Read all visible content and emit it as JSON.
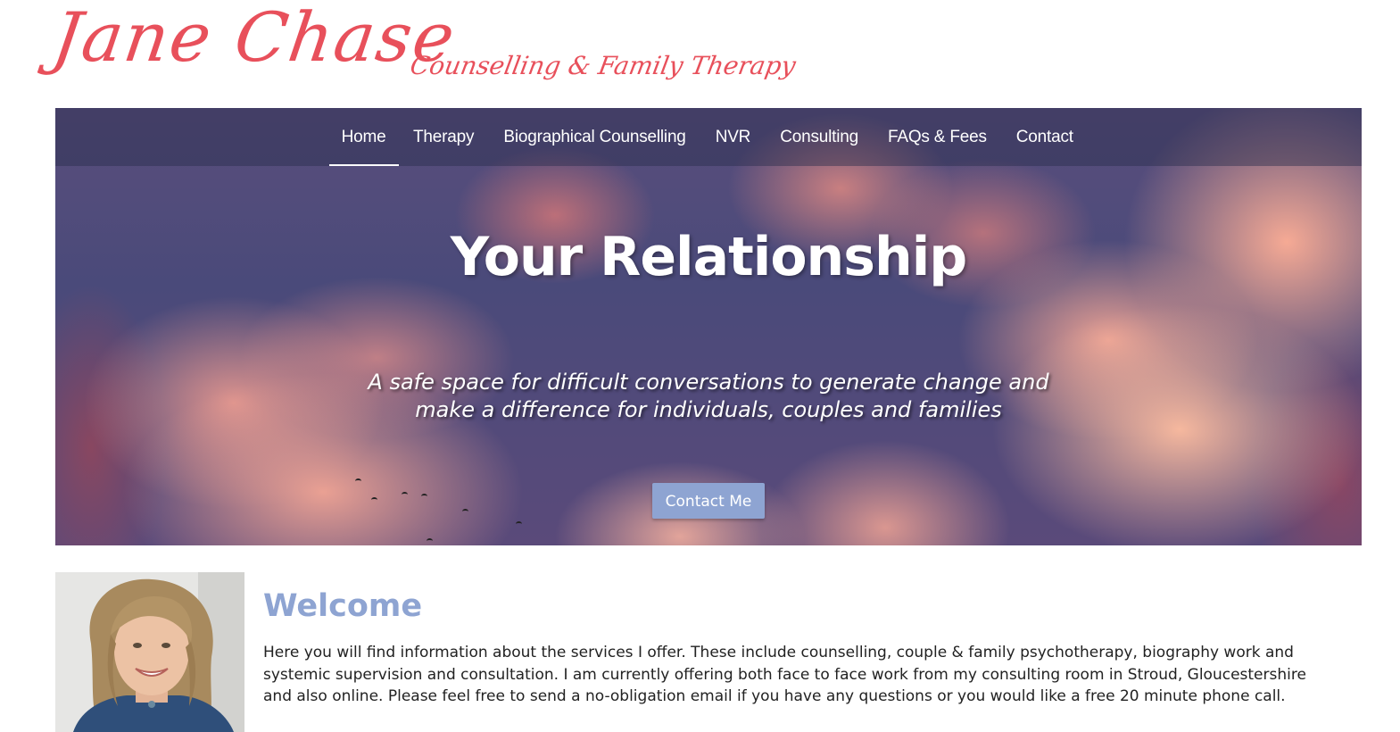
{
  "brand": {
    "name": "Jane Chase",
    "tagline": "Counselling & Family Therapy",
    "color": "#e8505b"
  },
  "nav": {
    "items": [
      {
        "label": "Home",
        "active": true
      },
      {
        "label": "Therapy",
        "active": false
      },
      {
        "label": "Biographical Counselling",
        "active": false
      },
      {
        "label": "NVR",
        "active": false
      },
      {
        "label": "Consulting",
        "active": false
      },
      {
        "label": "FAQs & Fees",
        "active": false
      },
      {
        "label": "Contact",
        "active": false
      }
    ]
  },
  "hero": {
    "title": "Your Relationship",
    "subtitle_line1": "A safe space for difficult conversations to generate change and",
    "subtitle_line2": "make a difference for individuals, couples and families",
    "button_label": "Contact Me",
    "button_color": "#8ea4d2"
  },
  "welcome": {
    "title": "Welcome",
    "title_color": "#8ea4d2",
    "text": "Here you will find information about the services I offer. These include counselling, couple & family psychotherapy, biography work and systemic supervision and consultation. I am currently offering both face to face work from my consulting room in Stroud, Gloucestershire and also online. Please feel free to send a no-obligation email if you have any questions or you would like a free 20 minute phone call."
  }
}
